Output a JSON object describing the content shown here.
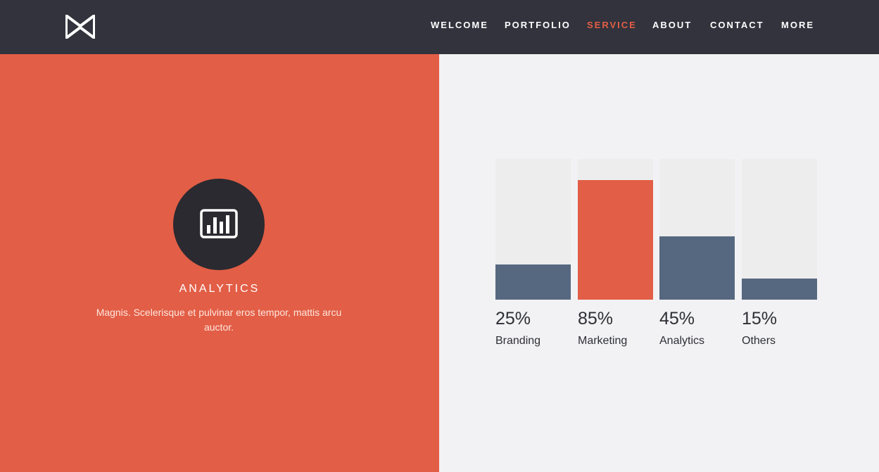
{
  "header": {
    "logo_icon": "bowtie-logo-icon",
    "nav": [
      {
        "label": "WELCOME",
        "active": false
      },
      {
        "label": "PORTFOLIO",
        "active": false
      },
      {
        "label": "SERVICE",
        "active": true
      },
      {
        "label": "ABOUT",
        "active": false
      },
      {
        "label": "CONTACT",
        "active": false
      },
      {
        "label": "MORE",
        "active": false
      }
    ]
  },
  "feature": {
    "icon": "bar-chart-icon",
    "title": "ANALYTICS",
    "description": "Magnis. Scelerisque et pulvinar eros tempor, mattis arcu auctor."
  },
  "colors": {
    "accent": "#e25e46",
    "dark": "#32333c",
    "bar_default": "#566780",
    "bar_highlight": "#e25e46",
    "track": "#ededed"
  },
  "chart_data": {
    "type": "bar",
    "categories": [
      "Branding",
      "Marketing",
      "Analytics",
      "Others"
    ],
    "values": [
      25,
      85,
      45,
      15
    ],
    "value_labels": [
      "25%",
      "85%",
      "45%",
      "15%"
    ],
    "highlight_index": 1,
    "ylim": [
      0,
      100
    ],
    "grid": false
  }
}
